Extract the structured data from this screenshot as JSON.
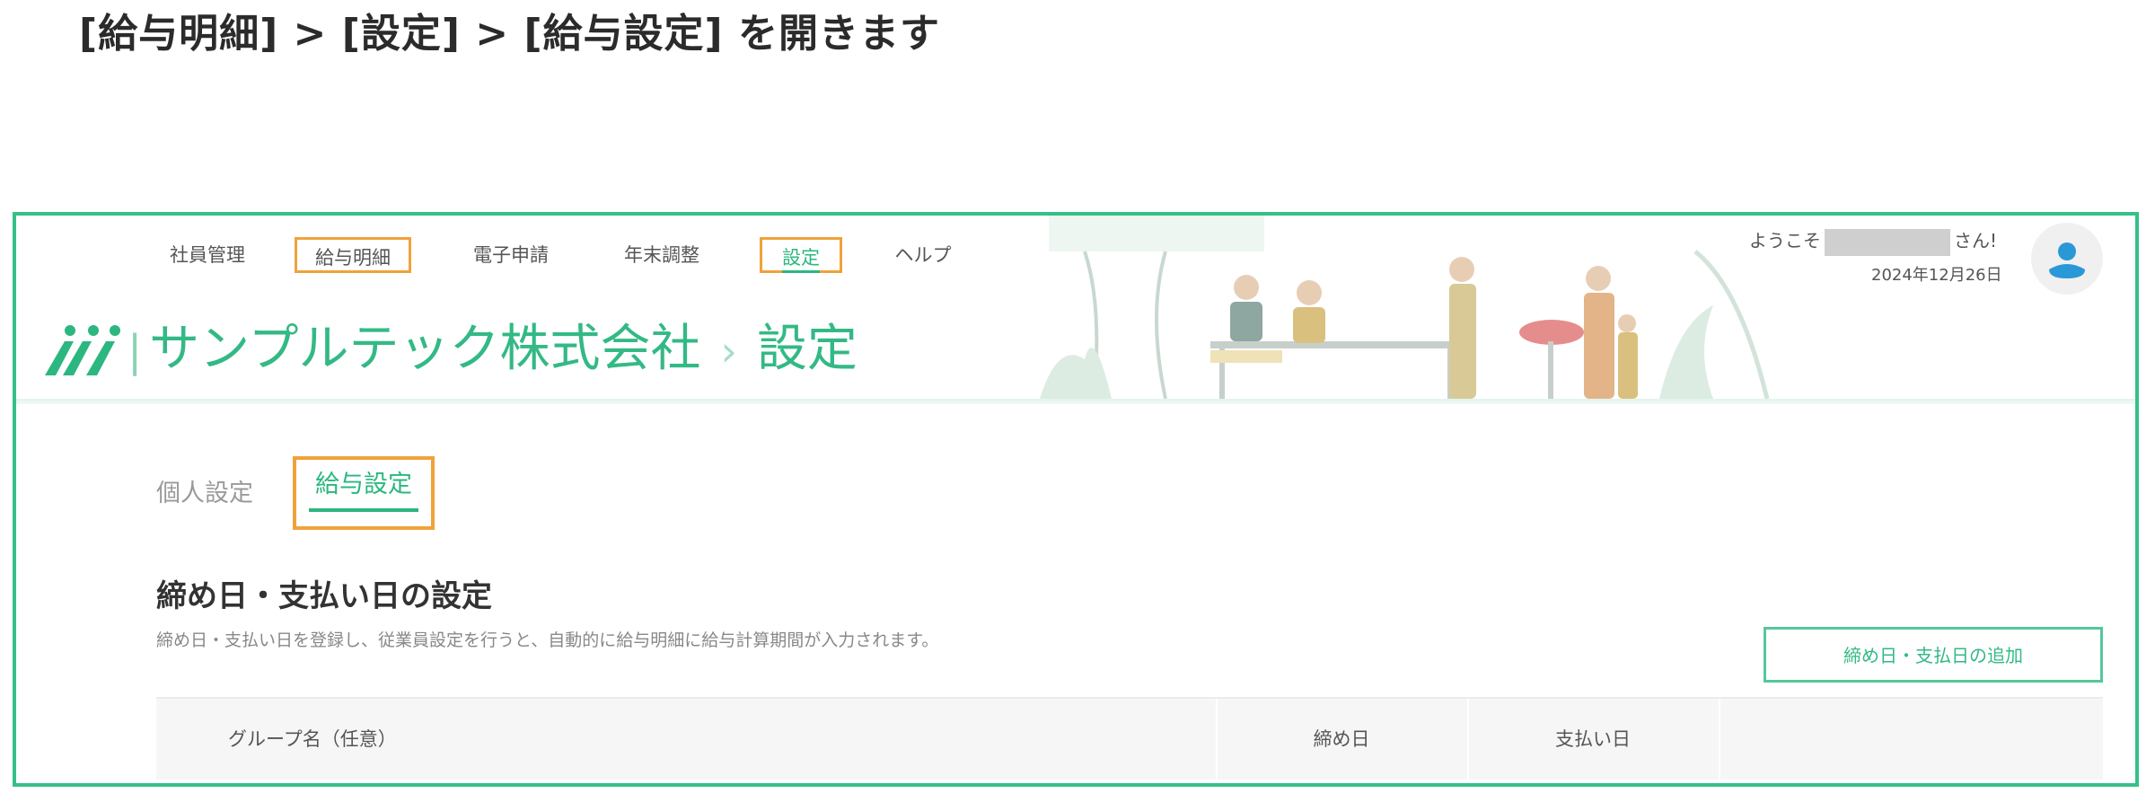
{
  "instruction": "[給与明細] > [設定] > [給与設定] を開きます",
  "nav": {
    "items": [
      {
        "label": "社員管理"
      },
      {
        "label": "給与明細"
      },
      {
        "label": "電子申請"
      },
      {
        "label": "年末調整"
      },
      {
        "label": "設定"
      },
      {
        "label": "ヘルプ"
      }
    ]
  },
  "header": {
    "company": "サンプルテック株式会社",
    "page": "設定",
    "welcome_prefix": "ようこそ",
    "welcome_suffix": "さん!",
    "date": "2024年12月26日"
  },
  "tabs": [
    {
      "label": "個人設定"
    },
    {
      "label": "給与設定"
    }
  ],
  "section": {
    "title": "締め日・支払い日の設定",
    "description": "締め日・支払い日を登録し、従業員設定を行うと、自動的に給与明細に給与計算期間が入力されます。",
    "add_button": "締め日・支払日の追加"
  },
  "table": {
    "columns": [
      "グループ名（任意）",
      "締め日",
      "支払い日",
      ""
    ]
  },
  "colors": {
    "brand": "#35c088",
    "highlight": "#f0a23a"
  },
  "icons": {
    "logo": "brand-logo",
    "avatar": "user-avatar-icon"
  }
}
